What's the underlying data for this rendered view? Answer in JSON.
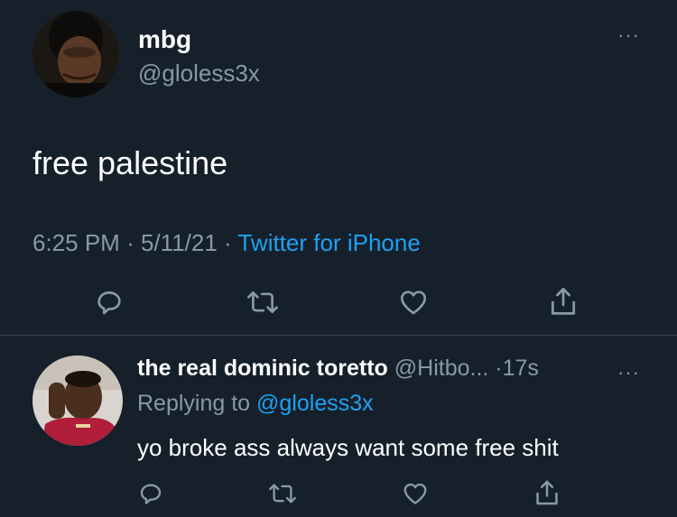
{
  "tweet": {
    "author_name": "mbg",
    "author_handle": "@gloless3x",
    "text": "free palestine",
    "time": "6:25 PM",
    "date": "5/11/21",
    "source": "Twitter for iPhone",
    "sep1": "·",
    "sep2": "·",
    "more": "···"
  },
  "reply": {
    "author_name": "the real dominic toretto",
    "author_handle": "@Hitbo...",
    "sep": "·",
    "age": "17s",
    "more": "···",
    "replying_prefix": "Replying to",
    "replying_handle": "@gloless3x",
    "text": "yo broke ass always want some free shit"
  },
  "icons": [
    "reply-icon",
    "retweet-icon",
    "like-icon",
    "share-icon",
    "more-icon"
  ],
  "colors": {
    "background": "#15202b",
    "secondary": "#8899a6",
    "accent": "#1da1f2",
    "divider": "#38444d"
  }
}
